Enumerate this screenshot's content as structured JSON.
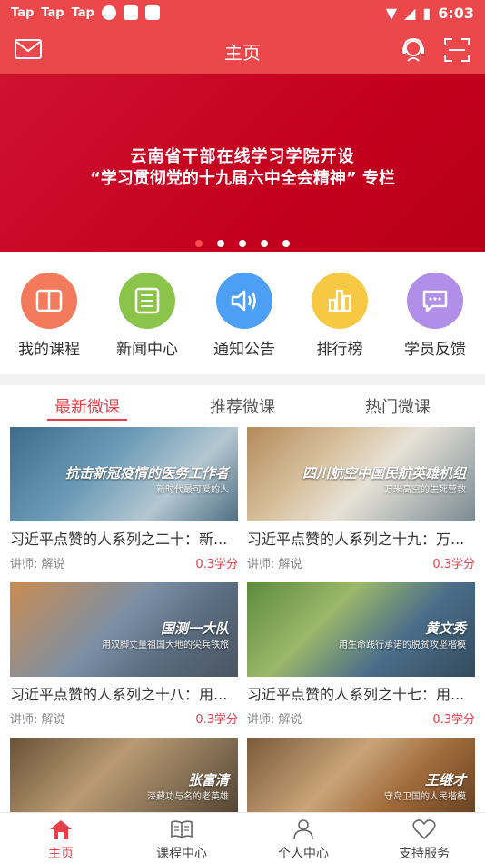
{
  "status_bar": {
    "left_items": [
      "Tap",
      "Tap",
      "Tap"
    ],
    "time": "6:03"
  },
  "header": {
    "title": "主页"
  },
  "banner": {
    "line1": "云南省干部在线学习学院开设",
    "line2": "“学习贯彻党的十九届六中全会精神” 专栏"
  },
  "quick_links": [
    {
      "label": "我的课程",
      "icon": "book-icon",
      "color": "#f47a5e"
    },
    {
      "label": "新闻中心",
      "icon": "newspaper-icon",
      "color": "#8bc44a"
    },
    {
      "label": "通知公告",
      "icon": "speaker-icon",
      "color": "#4c9ff4"
    },
    {
      "label": "排行榜",
      "icon": "bar-chart-icon",
      "color": "#f7c843"
    },
    {
      "label": "学员反馈",
      "icon": "chat-icon",
      "color": "#b18ee8"
    }
  ],
  "tabs": [
    {
      "label": "最新微课",
      "active": true
    },
    {
      "label": "推荐微课",
      "active": false
    },
    {
      "label": "热门微课",
      "active": false
    }
  ],
  "courses": [
    {
      "title": "习近平点赞的人系列之二十：新...",
      "lecturer": "讲师:  解说",
      "credit": "0.3学分",
      "caption": "抗击新冠疫情的医务工作者",
      "subcaption": "新时代最可爱的人"
    },
    {
      "title": "习近平点赞的人系列之十九：万...",
      "lecturer": "讲师:  解说",
      "credit": "0.3学分",
      "caption": "四川航空中国民航英雄机组",
      "subcaption": "万米高空的生死营救"
    },
    {
      "title": "习近平点赞的人系列之十八：用...",
      "lecturer": "讲师:  解说",
      "credit": "0.3学分",
      "caption": "国测一大队",
      "subcaption": "用双脚丈量祖国大地的尖兵铁旅"
    },
    {
      "title": "习近平点赞的人系列之十七：用...",
      "lecturer": "讲师:  解说",
      "credit": "0.3学分",
      "caption": "黄文秀",
      "subcaption": "用生命践行承诺的脱贫攻坚楷模"
    },
    {
      "title": "",
      "lecturer": "",
      "credit": "",
      "caption": "张富清",
      "subcaption": "深藏功与名的老英雄"
    },
    {
      "title": "",
      "lecturer": "",
      "credit": "",
      "caption": "王继才",
      "subcaption": "守岛卫国的人民楷模"
    }
  ],
  "bottom_nav": [
    {
      "label": "主页",
      "icon": "home-icon",
      "active": true
    },
    {
      "label": "课程中心",
      "icon": "open-book-icon",
      "active": false
    },
    {
      "label": "个人中心",
      "icon": "person-icon",
      "active": false
    },
    {
      "label": "支持服务",
      "icon": "heart-icon",
      "active": false
    }
  ],
  "colors": {
    "brand_red": "#ec484b",
    "accent_red": "#e8404a",
    "banner_red": "#c4001e"
  }
}
